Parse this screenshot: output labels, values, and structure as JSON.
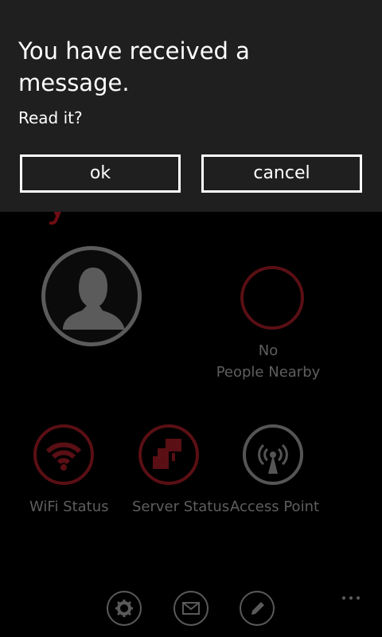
{
  "dialog": {
    "title": "You have received a message.",
    "text": "Read it?",
    "ok_label": "ok",
    "cancel_label": "cancel"
  },
  "app": {
    "nearby": {
      "line1": "No",
      "line2": "People Nearby"
    },
    "status": [
      {
        "label": "WiFi Status",
        "icon": "wifi-icon"
      },
      {
        "label": "Server Status",
        "icon": "server-icon"
      },
      {
        "label": "Access Point",
        "icon": "access-point-icon"
      }
    ],
    "app_bar": [
      {
        "icon": "gear-icon"
      },
      {
        "icon": "mail-icon"
      },
      {
        "icon": "pencil-icon"
      }
    ]
  },
  "colors": {
    "accent": "#5a0f14",
    "dialog_bg": "#1f1f1f",
    "dimmed_text": "#5e5e5e"
  }
}
